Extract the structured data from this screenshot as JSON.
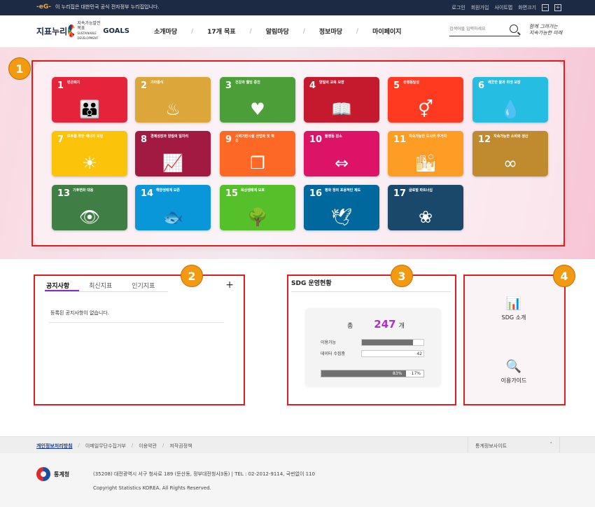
{
  "topbar": {
    "gov_logo": "-eG-",
    "gov_text": "이 누리집은 대한민국 공식 전자정부 누리집입니다.",
    "util": [
      "로그인",
      "회원가입",
      "사이트맵",
      "화면크기"
    ],
    "zoom_minus": "−",
    "zoom_plus": "+"
  },
  "header": {
    "logo_main": "지표누리",
    "logo_sdg_line1": "지속가능발전목표",
    "logo_sdg_line2": "SUSTAINABLE DEVELOPMENT",
    "logo_goals": "GOALS",
    "nav": [
      "소개마당",
      "17개 목표",
      "알림마당",
      "정보마당",
      "마이페이지"
    ],
    "search_placeholder": "검색어를 입력하세요",
    "slogan_line1": "함께 그려가는",
    "slogan_line2": "지속가능한 미래"
  },
  "badges": [
    "1",
    "2",
    "3",
    "4"
  ],
  "goals": [
    {
      "num": "1",
      "label": "빈곤퇴치",
      "color": "#e5243b",
      "icon": "family-icon",
      "glyph": "👪"
    },
    {
      "num": "2",
      "label": "기아종식",
      "color": "#dda63a",
      "icon": "bowl-icon",
      "glyph": "♨"
    },
    {
      "num": "3",
      "label": "건강과 웰빙 증진",
      "color": "#4c9f38",
      "icon": "heartbeat-icon",
      "glyph": "♥"
    },
    {
      "num": "4",
      "label": "양질의 교육 보장",
      "color": "#c5192d",
      "icon": "book-icon",
      "glyph": "📖"
    },
    {
      "num": "5",
      "label": "성평등달성",
      "color": "#ff3a21",
      "icon": "gender-icon",
      "glyph": "⚥"
    },
    {
      "num": "6",
      "label": "깨끗한 물과 위생 보장",
      "color": "#26bde2",
      "icon": "water-icon",
      "glyph": "💧"
    },
    {
      "num": "7",
      "label": "모두를 위한 에너지 보장",
      "color": "#fcc30b",
      "icon": "sun-icon",
      "glyph": "☀"
    },
    {
      "num": "8",
      "label": "경제성장과 양질의 일자리",
      "color": "#a21942",
      "icon": "growth-chart-icon",
      "glyph": "📈"
    },
    {
      "num": "9",
      "label": "사회기반시설 산업화 및 혁신",
      "color": "#fd6925",
      "icon": "cubes-icon",
      "glyph": "❒"
    },
    {
      "num": "10",
      "label": "불평등 감소",
      "color": "#dd1367",
      "icon": "equality-icon",
      "glyph": "⇔"
    },
    {
      "num": "11",
      "label": "지속가능한 도시와 주거지",
      "color": "#fd9d24",
      "icon": "city-icon",
      "glyph": "🏙"
    },
    {
      "num": "12",
      "label": "지속가능한 소비와 생산",
      "color": "#bf8b2e",
      "icon": "infinity-icon",
      "glyph": "∞"
    },
    {
      "num": "13",
      "label": "기후변화 대응",
      "color": "#3f7e44",
      "icon": "eye-globe-icon",
      "glyph": "👁"
    },
    {
      "num": "14",
      "label": "해양생태계 보존",
      "color": "#0a97d9",
      "icon": "fish-icon",
      "glyph": "🐟"
    },
    {
      "num": "15",
      "label": "육상생태계 보호",
      "color": "#56c02b",
      "icon": "tree-icon",
      "glyph": "🌳"
    },
    {
      "num": "16",
      "label": "평화 정의 포용적인 제도",
      "color": "#00689d",
      "icon": "dove-icon",
      "glyph": "🕊"
    },
    {
      "num": "17",
      "label": "글로벌 파트너십",
      "color": "#19486a",
      "icon": "flower-rings-icon",
      "glyph": "❀"
    }
  ],
  "notice": {
    "tabs": [
      "공지사항",
      "최신지표",
      "인기지표"
    ],
    "plus": "+",
    "empty": "등록된 공지사항이 없습니다."
  },
  "status": {
    "title": "SDG 운영현황",
    "total_label": "총",
    "total_value": "247",
    "total_unit": "개",
    "rows": [
      {
        "label": "이용가능",
        "value": "205",
        "fraction": 0.83
      },
      {
        "label": "데이터 수집중",
        "value": "42",
        "fraction": 0.17
      }
    ],
    "pct_left": "83%",
    "pct_right": "17%",
    "progress": 0.83
  },
  "quick": [
    {
      "label": "SDG 소개",
      "icon": "presentation-icon",
      "glyph": "📊"
    },
    {
      "label": "이용가이드",
      "icon": "guide-icon",
      "glyph": "🔍"
    }
  ],
  "footer": {
    "links": [
      "개인정보처리방침",
      "이메일무단수집거부",
      "이용약관",
      "저작권정책"
    ],
    "site_select": "통계정보사이트",
    "site_chevron": "˄",
    "org": "통계청",
    "addr": "(35208) 대전광역시 서구 청사로 189 (둔산동, 정부대전청사3동)  |  TEL : 02-2012-9114, 국번없이 110",
    "copyright": "Copyright Statistics KOREA. All Rights Reserved."
  }
}
